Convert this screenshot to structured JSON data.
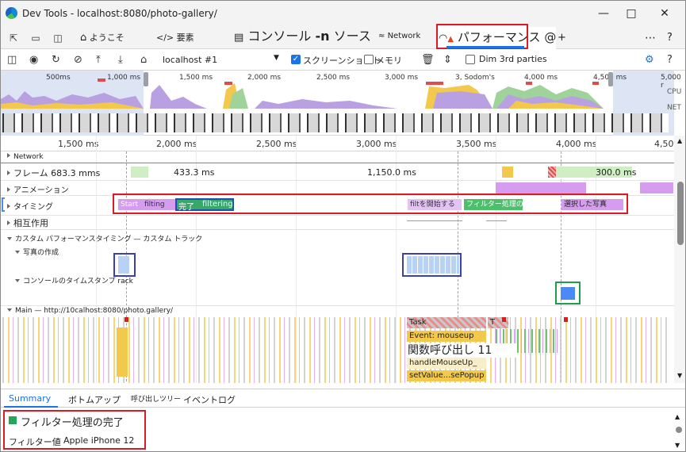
{
  "window": {
    "title": "Dev Tools - localhost:8080/photo-gallery/"
  },
  "tabs": {
    "welcome": "ようこそ",
    "elements": "要素",
    "console": "コンソール",
    "n_label": "-n",
    "sources": "ソース",
    "network": "Network",
    "performance": "パフォーマンス",
    "at": "@",
    "plus": "+"
  },
  "toolbar": {
    "target": "localhost #1",
    "screenshots_label": "スクリーンショット",
    "screenshots_checked": true,
    "memory_label": "メモリ",
    "memory_checked": false,
    "dim3rd_label": "Dim 3rd parties",
    "dim3rd_checked": false
  },
  "overview": {
    "ticks": [
      "500ms",
      "1,000 ms",
      "1,500 ms",
      "2,000 ms",
      "2,500 ms",
      "3,000 ms",
      "3, Sodom's",
      "4,000 ms",
      "4,500 ms",
      "5,000 r"
    ],
    "cpu_label": "CPU",
    "net_label": "NET"
  },
  "ruler": {
    "ticks": [
      "1,500 ms",
      "2,000 ms",
      "2,500 ms",
      "3,000 ms",
      "3,500 ms",
      "4,000 ms",
      "4,50"
    ]
  },
  "tracks": {
    "network": "Network",
    "frames": "フレーム 683.3 mms",
    "frame_values": [
      "433.3 ms",
      "1,150.0 ms",
      "300.0 ms"
    ],
    "animation": "アニメーション",
    "timing": "タイミング",
    "timing_marks": {
      "start": "Start",
      "filting": "filting",
      "complete": "完了",
      "filtering": "filtering",
      "filt_start": "filtを開始する",
      "filter_done": "フィルター処理の完",
      "selected_photo": "選択した写真"
    },
    "interactions": "相互作用",
    "custom_track": "カスタム パフォーマンスタイミング — カスタム トラック",
    "photo_creation": "写真の作成",
    "console_stamp": "コンソールのタイムスタンプ rack",
    "main": "Main — http://10calhost:8080/photo.gallery/",
    "flame": {
      "task": "Task",
      "t": "T",
      "event": "Event: mouseup",
      "func_call": "関数呼び出し 11",
      "handle": "handleMouseUp_",
      "setvalue": "setValue...sePopup"
    }
  },
  "bottom": {
    "tabs": [
      "Summary",
      "ボトムアップ",
      "呼び出しツリー",
      "イベントログ"
    ],
    "summary_title": "フィルター処理の完了",
    "summary_color": "#27a55a",
    "field_label": "フィルター値",
    "field_value": "Apple iPhone 12"
  }
}
